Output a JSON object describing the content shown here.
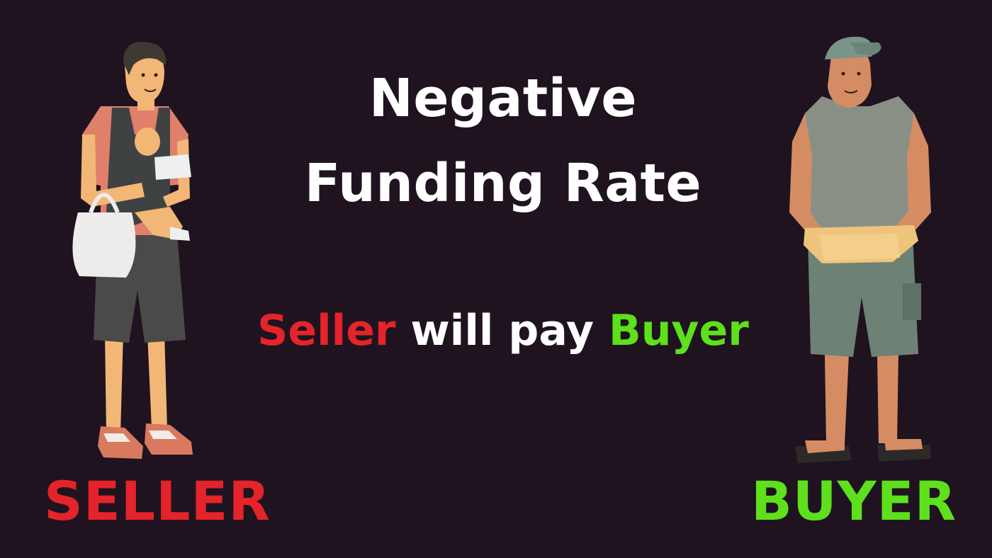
{
  "title": {
    "line1": "Negative",
    "line2": "Funding Rate"
  },
  "subtitle": {
    "part1": "Seller",
    "part2": " will pay ",
    "part3": "Buyer"
  },
  "labels": {
    "seller": "SELLER",
    "buyer": "BUYER"
  },
  "colors": {
    "background": "#1f1320",
    "seller": "#e5232a",
    "buyer": "#5ee01c",
    "text": "#ffffff"
  },
  "figures": {
    "left": "man-carrying-baby-illustration",
    "right": "man-with-cap-and-waist-bag-illustration"
  }
}
